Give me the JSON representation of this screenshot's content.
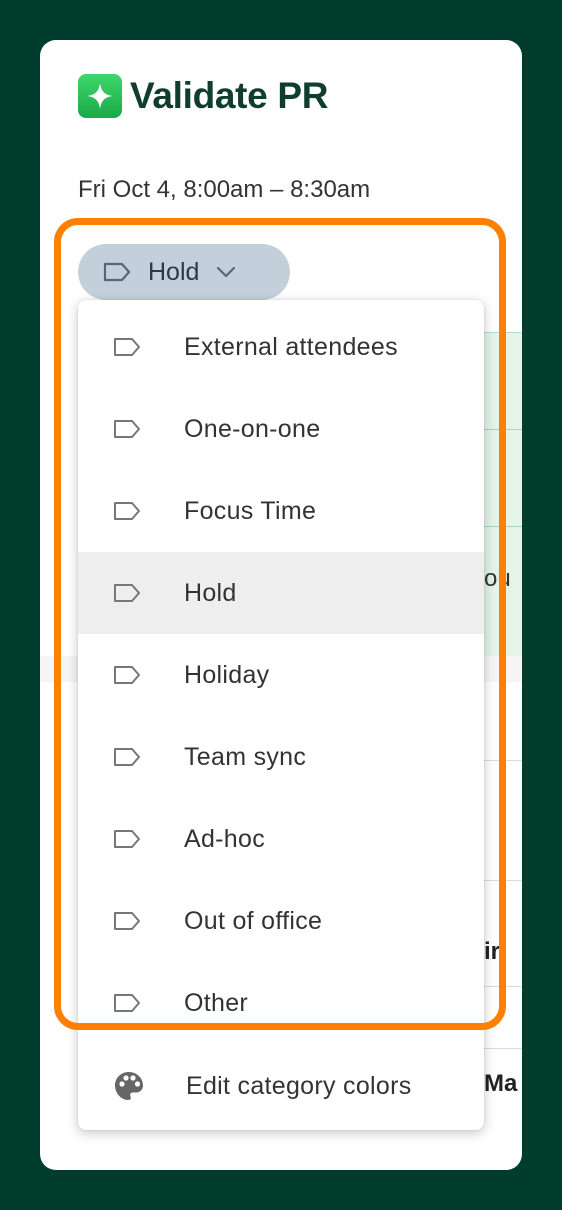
{
  "card": {
    "title": "Validate PR",
    "event_time": "Fri Oct 4, 8:00am – 8:30am"
  },
  "category_chip": {
    "label": "Hold",
    "icon": "tag-icon",
    "chevron": "chevron-down-icon"
  },
  "dropdown": {
    "items": [
      {
        "label": "External attendees",
        "icon": "tag-icon"
      },
      {
        "label": "One-on-one",
        "icon": "tag-icon"
      },
      {
        "label": "Focus Time",
        "icon": "tag-icon"
      },
      {
        "label": "Hold",
        "icon": "tag-icon",
        "selected": true
      },
      {
        "label": "Holiday",
        "icon": "tag-icon"
      },
      {
        "label": "Team sync",
        "icon": "tag-icon"
      },
      {
        "label": "Ad-hoc",
        "icon": "tag-icon"
      },
      {
        "label": "Out of office",
        "icon": "tag-icon"
      },
      {
        "label": "Other",
        "icon": "tag-icon"
      }
    ],
    "edit_colors": {
      "label": "Edit category colors",
      "icon": "palette-icon"
    }
  },
  "background_fragments": {
    "text_1": "ou",
    "text_2": "ir",
    "text_3": "Ma"
  },
  "colors": {
    "page_background": "#003d2d",
    "title": "#0f3d2e",
    "chip_background": "#c3d0dc",
    "selected_row": "#eeeeee",
    "highlight_border": "#ff7f00",
    "sparkle_green": "#2bc45a"
  }
}
